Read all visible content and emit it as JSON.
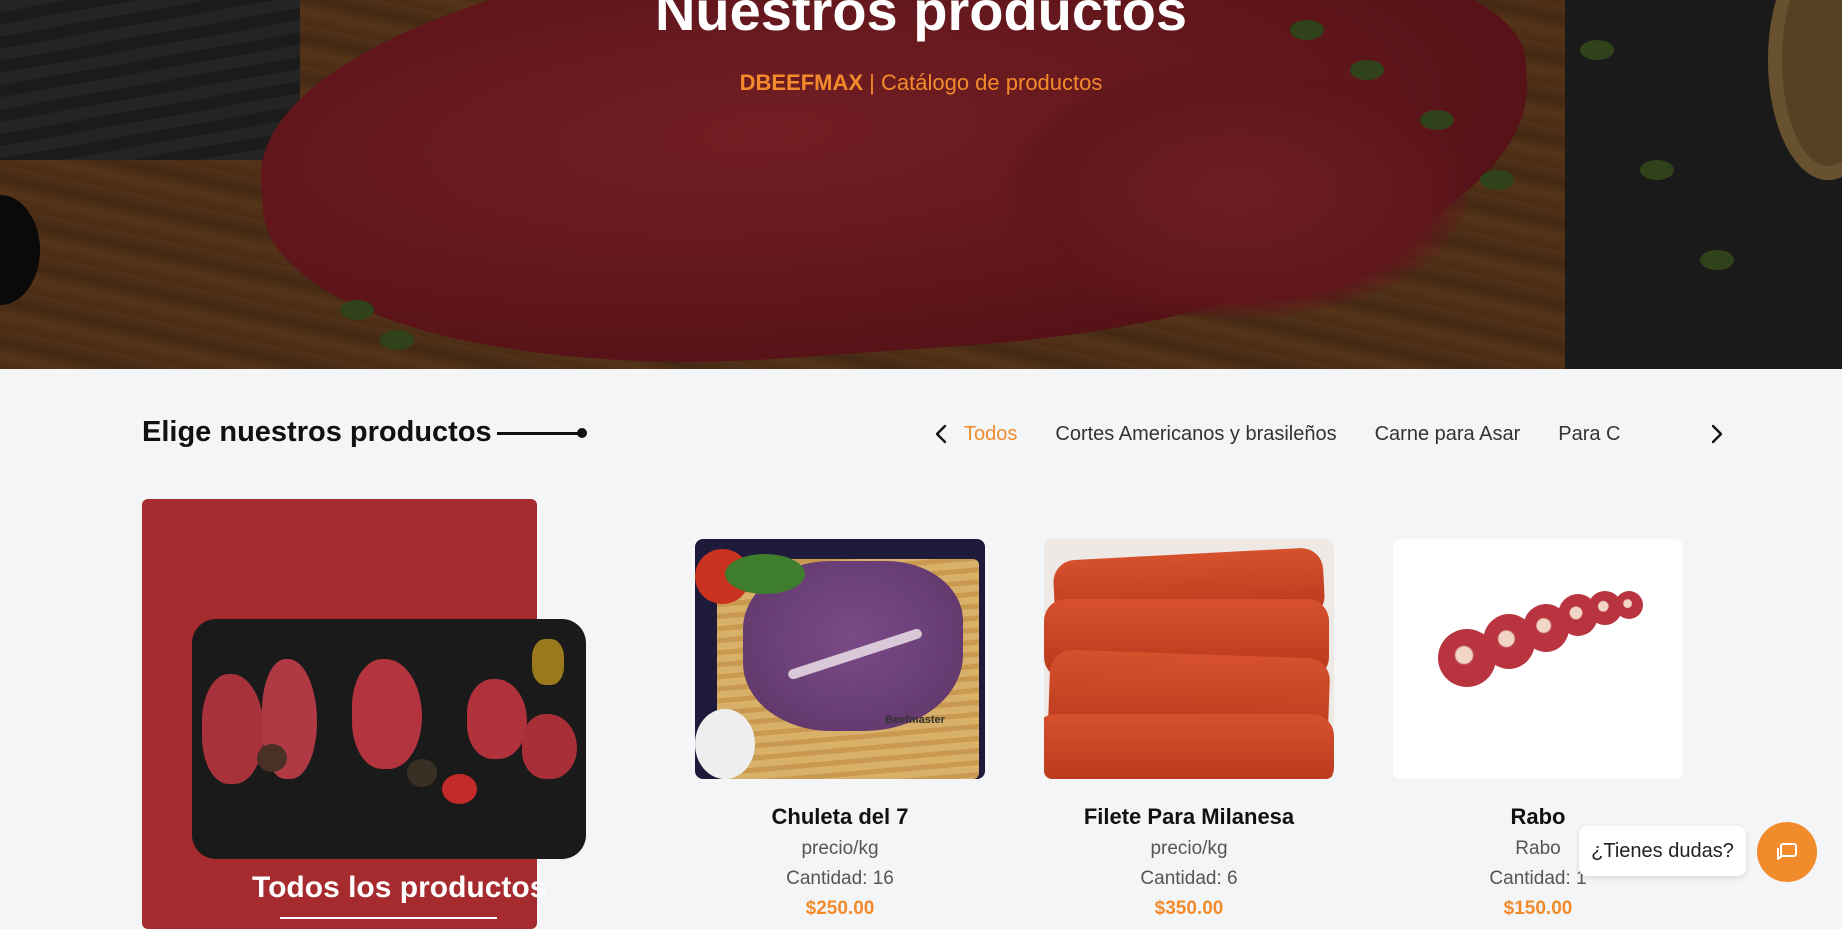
{
  "hero": {
    "title": "Nuestros productos",
    "brand": "DBEEFMAX",
    "subtitle": " | Catálogo de productos"
  },
  "section": {
    "title": "Elige nuestros productos"
  },
  "tabs": {
    "prev_icon": "chevron-left-icon",
    "next_icon": "chevron-right-icon",
    "items": [
      {
        "label": "Todos",
        "active": true
      },
      {
        "label": "Cortes Americanos y brasileños",
        "active": false
      },
      {
        "label": "Carne para Asar",
        "active": false
      },
      {
        "label": "Para C",
        "active": false
      }
    ]
  },
  "featured": {
    "label": "Todos los productos"
  },
  "products": [
    {
      "name": "Chuleta del 7",
      "unit": "precio/kg",
      "quantity": "Cantidad: 16",
      "price": "$250.00"
    },
    {
      "name": "Filete Para Milanesa",
      "unit": "precio/kg",
      "quantity": "Cantidad: 6",
      "price": "$350.00"
    },
    {
      "name": "Rabo",
      "unit": "Rabo",
      "quantity": "Cantidad: 1",
      "price": "$150.00"
    }
  ],
  "chat": {
    "bubble_text": "¿Tienes dudas?",
    "icon": "chat-icon"
  },
  "colors": {
    "accent": "#f28b2c",
    "card_red": "#a62b2f",
    "background": "#f4f5f7"
  }
}
